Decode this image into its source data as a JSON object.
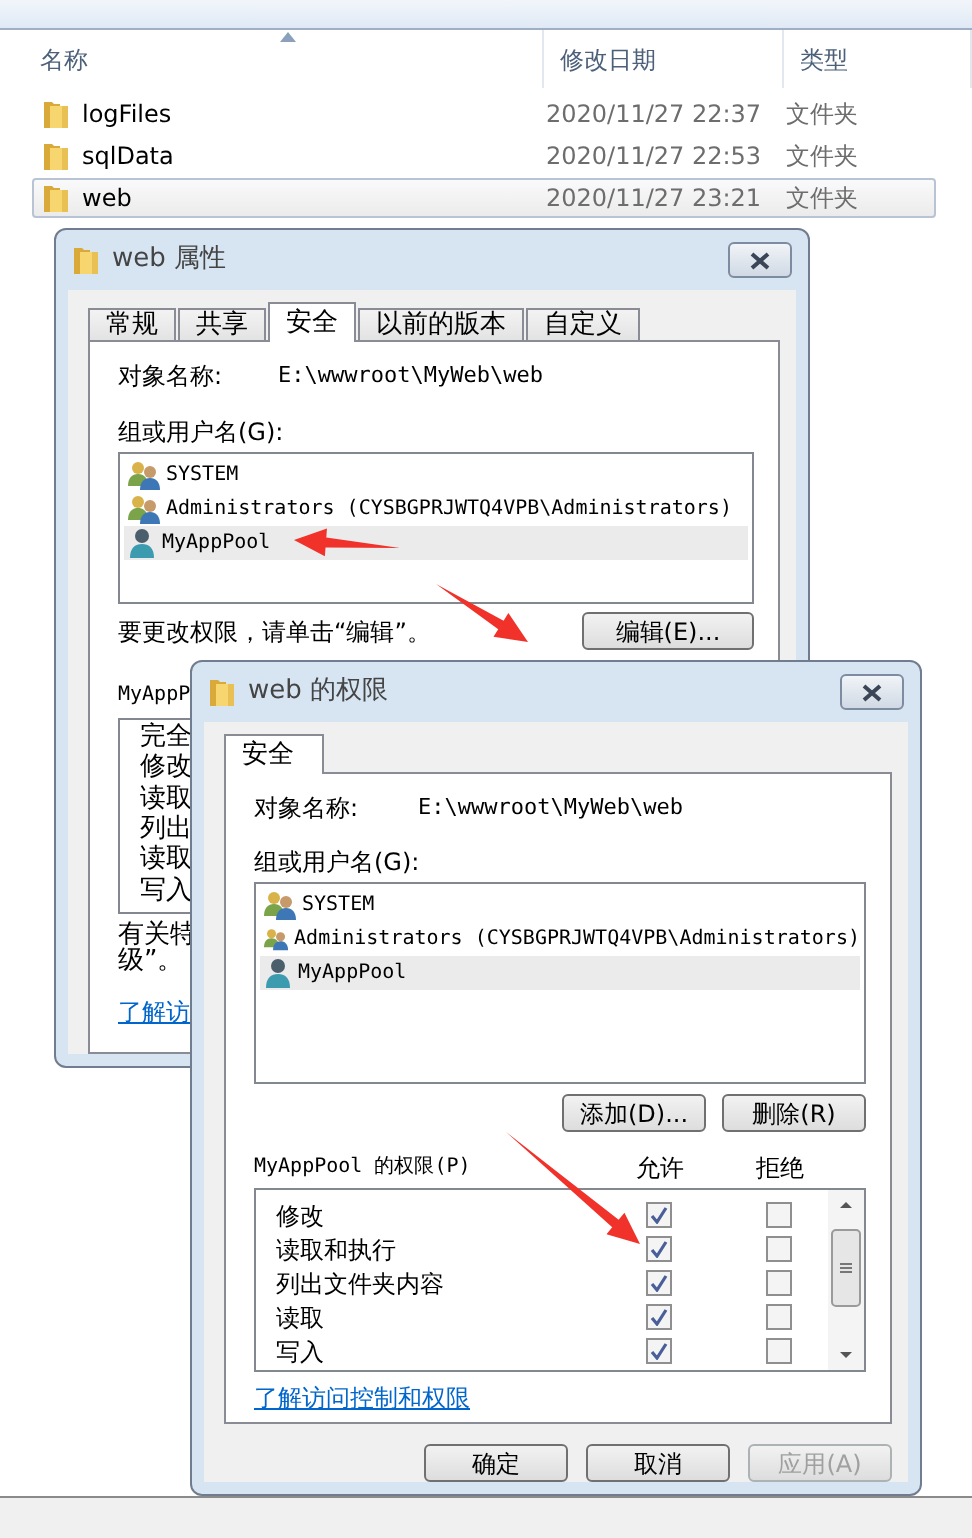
{
  "explorer": {
    "columns": [
      {
        "label": "名称",
        "sorted": true
      },
      {
        "label": "修改日期",
        "sorted": false
      },
      {
        "label": "类型",
        "sorted": false
      }
    ],
    "files": [
      {
        "name": "logFiles",
        "modified": "2020/11/27 22:37",
        "type": "文件夹",
        "selected": false
      },
      {
        "name": "sqlData",
        "modified": "2020/11/27 22:53",
        "type": "文件夹",
        "selected": false
      },
      {
        "name": "web",
        "modified": "2020/11/27 23:21",
        "type": "文件夹",
        "selected": true
      }
    ]
  },
  "properties_window": {
    "title": "web 属性",
    "tabs": [
      {
        "label": "常规",
        "selected": false
      },
      {
        "label": "共享",
        "selected": false
      },
      {
        "label": "安全",
        "selected": true
      },
      {
        "label": "以前的版本",
        "selected": false
      },
      {
        "label": "自定义",
        "selected": false
      }
    ],
    "object_label": "对象名称:",
    "object_path": "E:\\wwwroot\\MyWeb\\web",
    "users_label": "组或用户名(G):",
    "users": [
      {
        "name": "SYSTEM",
        "kind": "group",
        "selected": false
      },
      {
        "name": "Administrators (CYSBGPRJWTQ4VPB\\Administrators)",
        "kind": "group",
        "selected": false
      },
      {
        "name": "MyAppPool",
        "kind": "user",
        "selected": true
      }
    ],
    "edit_hint": "要更改权限，请单击“编辑”。",
    "edit_button": "编辑(E)...",
    "permissions_label": "MyAppP",
    "permissions": [
      "完全",
      "修改",
      "读取",
      "列出",
      "读取",
      "写入"
    ],
    "info_lines": [
      "有关特",
      "级”。"
    ],
    "link": "了解访"
  },
  "permissions_window": {
    "title": "web 的权限",
    "tabs": [
      {
        "label": "安全",
        "selected": true
      }
    ],
    "object_label": "对象名称:",
    "object_path": "E:\\wwwroot\\MyWeb\\web",
    "users_label": "组或用户名(G):",
    "users": [
      {
        "name": "SYSTEM",
        "kind": "group",
        "selected": false
      },
      {
        "name": "Administrators (CYSBGPRJWTQ4VPB\\Administrators)",
        "kind": "group",
        "selected": false
      },
      {
        "name": "MyAppPool",
        "kind": "user",
        "selected": true
      }
    ],
    "add_button": "添加(D)...",
    "remove_button": "删除(R)",
    "permissions_label": "MyAppPool 的权限(P)",
    "allow_label": "允许",
    "deny_label": "拒绝",
    "permissions": [
      {
        "name": "修改",
        "allow": true,
        "deny": false
      },
      {
        "name": "读取和执行",
        "allow": true,
        "deny": false
      },
      {
        "name": "列出文件夹内容",
        "allow": true,
        "deny": false
      },
      {
        "name": "读取",
        "allow": true,
        "deny": false
      },
      {
        "name": "写入",
        "allow": true,
        "deny": false
      }
    ],
    "link": "了解访问控制和权限",
    "buttons": [
      {
        "label": "确定",
        "disabled": false
      },
      {
        "label": "取消",
        "disabled": false
      },
      {
        "label": "应用(A)",
        "disabled": true
      }
    ]
  }
}
